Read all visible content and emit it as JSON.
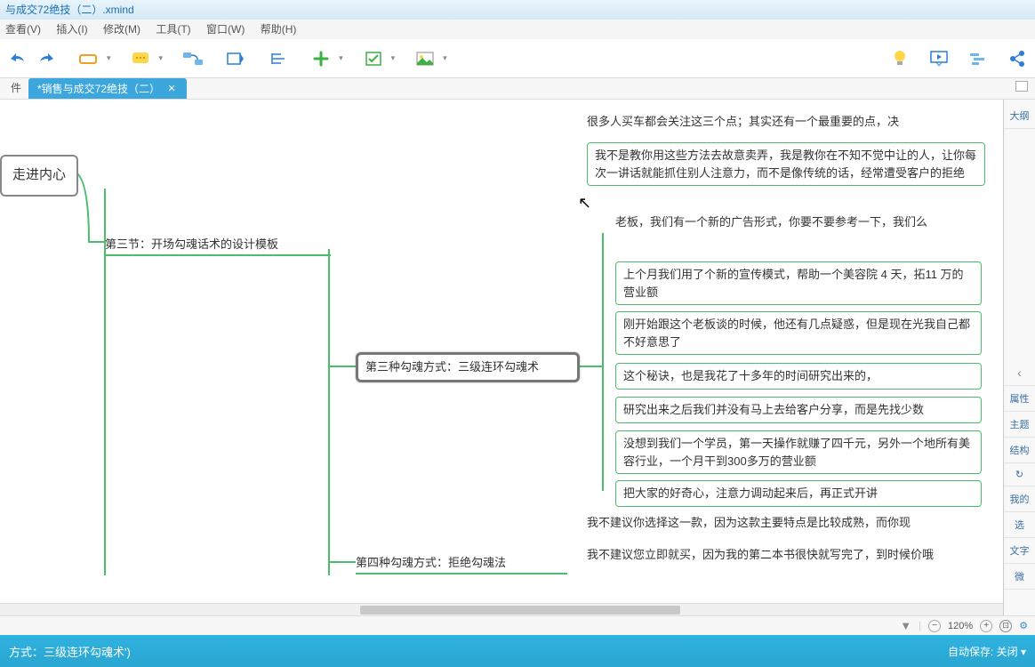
{
  "window": {
    "title": "与成交72绝技（二）.xmind"
  },
  "menu": {
    "view": "查看(V)",
    "insert": "插入(I)",
    "modify": "修改(M)",
    "tools": "工具(T)",
    "window": "窗口(W)",
    "help": "帮助(H)"
  },
  "tabs": {
    "file_label": "件",
    "active": "*销售与成交72绝技（二）"
  },
  "rightpanel": {
    "outline": "大纲",
    "properties": "属性",
    "theme": "主题",
    "structure": "结构",
    "mine": "我的",
    "select": "选",
    "text": "文字",
    "micro": "微"
  },
  "nodes": {
    "root": "走进内心",
    "branch3": "第三节：开场勾魂话术的设计模板",
    "method3": "第三种勾魂方式：三级连环勾魂术",
    "method4": "第四种勾魂方式：拒绝勾魂法",
    "t1": "很多人买车都会关注这三个点；其实还有一个最重要的点，决",
    "t2": "我不是教你用这些方法去故意卖弄，我是教你在不知不觉中让的人，让你每次一讲话就能抓住别人注意力，而不是像传统的话，经常遭受客户的拒绝",
    "t3": "老板，我们有一个新的广告形式，你要不要参考一下，我们么",
    "t4": "上个月我们用了个新的宣传模式，帮助一个美容院 4 天，拓11 万的营业额",
    "t5": "刚开始跟这个老板谈的时候，他还有几点疑惑，但是现在光我自己都不好意思了",
    "t6": "这个秘诀，也是我花了十多年的时间研究出来的，",
    "t7": "研究出来之后我们并没有马上去给客户分享，而是先找少数",
    "t8": "没想到我们一个学员，第一天操作就赚了四千元，另外一个地所有美容行业，一个月干到300多万的营业额",
    "t9": "把大家的好奇心，注意力调动起来后，再正式开讲",
    "t10": "我不建议你选择这一款，因为这款主要特点是比较成熟，而你现",
    "t11": "我不建议您立即就买，因为我的第二本书很快就写完了，到时候价哦"
  },
  "status": {
    "zoom": "120%"
  },
  "bottom": {
    "path": "方式：三级连环勾魂术')",
    "autosave": "自动保存: 关闭 ▾"
  },
  "right_scroll_label": "‹"
}
